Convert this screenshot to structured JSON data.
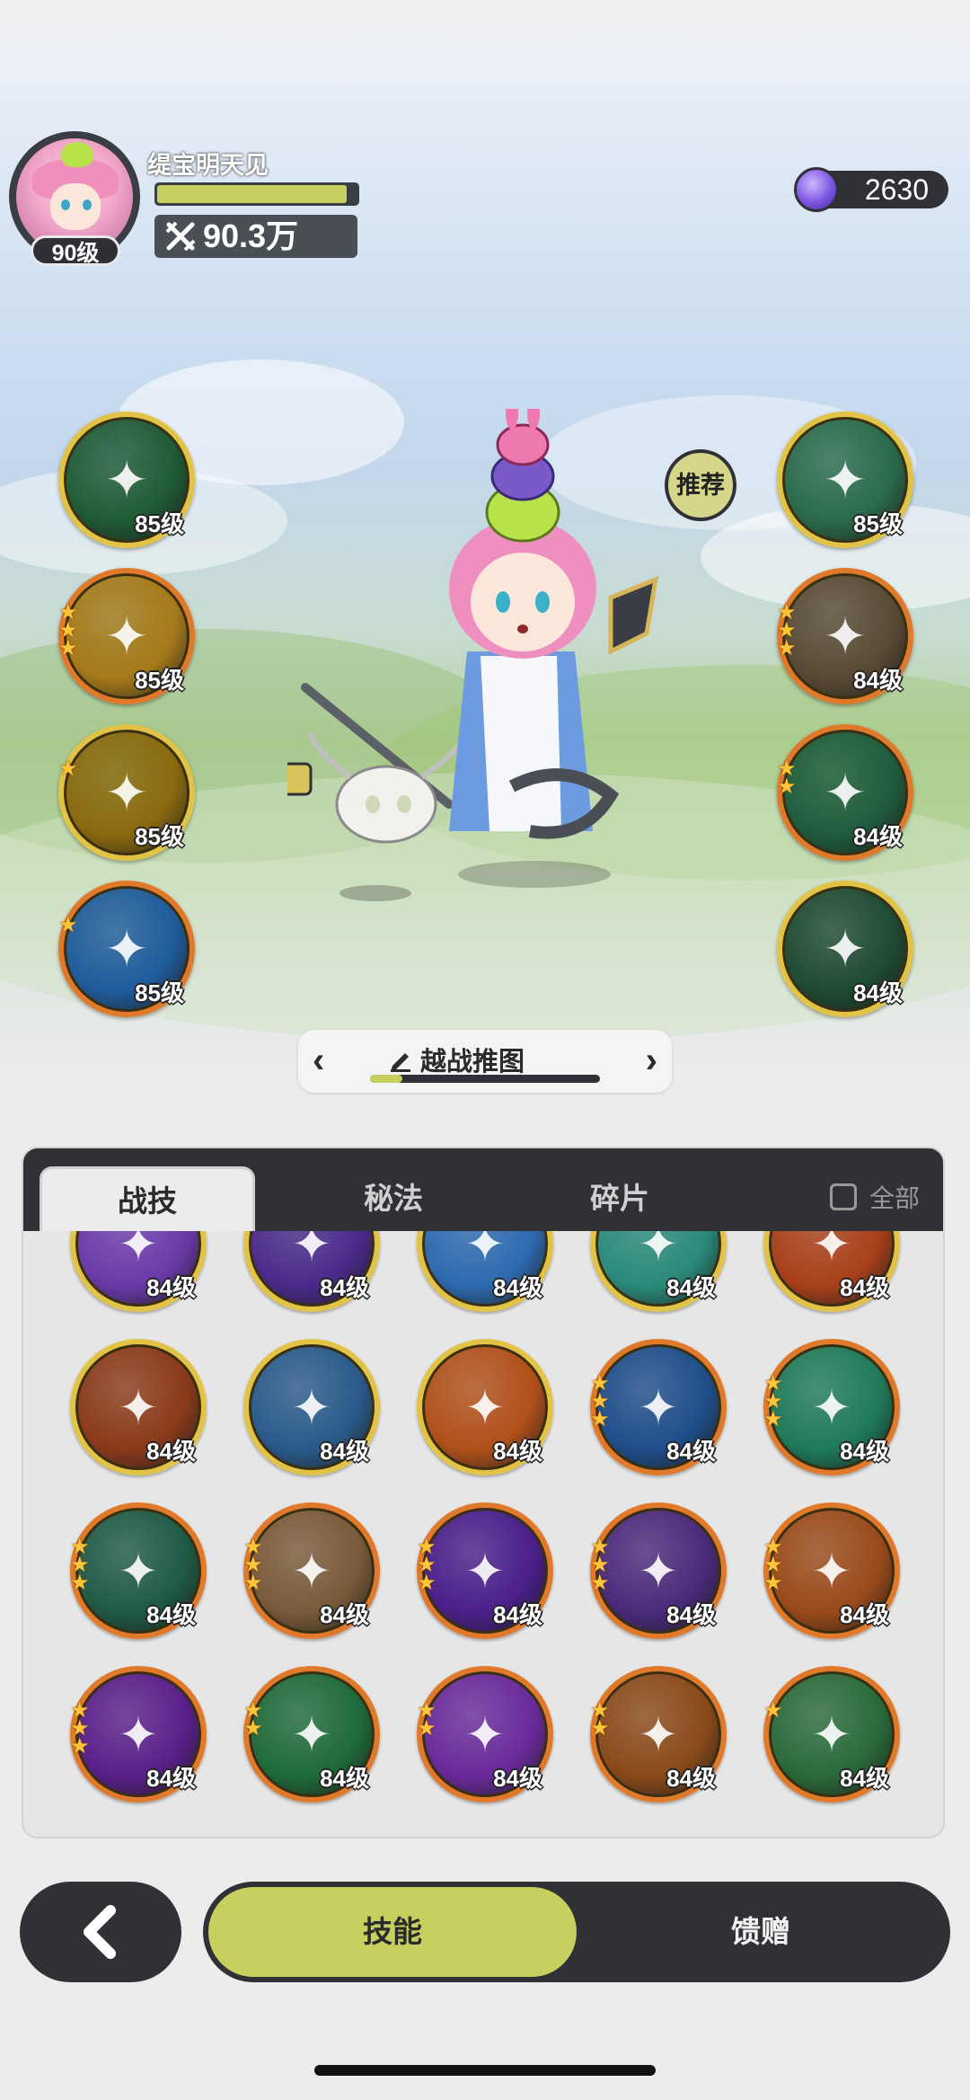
{
  "player": {
    "name": "缇宝明天见",
    "level": "90级",
    "power": "90.3万",
    "power_icon": "crossed-swords-icon",
    "hp_fraction": 0.95
  },
  "currency": {
    "icon": "purple-gem-icon",
    "amount": "2630"
  },
  "recommend_label": "推荐",
  "left_skills": [
    {
      "level": "85级",
      "stars": 0,
      "frame": "gold",
      "color": "#1f5a35",
      "icon": "healing-crosses-icon"
    },
    {
      "level": "85级",
      "stars": 3,
      "frame": "orange",
      "color": "#a57a1a",
      "icon": "golden-sparkle-crosses-icon"
    },
    {
      "level": "85级",
      "stars": 1,
      "frame": "gold",
      "color": "#8a6a10",
      "icon": "golden-pyramid-icon"
    },
    {
      "level": "85级",
      "stars": 1,
      "frame": "orange",
      "color": "#1f5c9c",
      "icon": "ice-shield-icon"
    }
  ],
  "right_skills": [
    {
      "level": "85级",
      "stars": 0,
      "frame": "gold",
      "color": "#2a6a4a",
      "icon": "green-heart-icon"
    },
    {
      "level": "84级",
      "stars": 3,
      "frame": "orange",
      "color": "#5a4a35",
      "icon": "arrow-up-holy-icon"
    },
    {
      "level": "84级",
      "stars": 2,
      "frame": "orange",
      "color": "#1f5c3e",
      "icon": "winged-emblem-icon"
    },
    {
      "level": "84级",
      "stars": 0,
      "frame": "gold",
      "color": "#1f4a33",
      "icon": "green-sparkle-icon"
    }
  ],
  "stage": {
    "title": "越战推图",
    "edit_icon": "pencil-icon",
    "progress": 0.14
  },
  "tabs": {
    "skills": "战技",
    "secret": "秘法",
    "fragments": "碎片",
    "all": "全部"
  },
  "grid": [
    {
      "level": "84级",
      "stars": 1,
      "frame": "gold",
      "color": "#6a3aa8",
      "icon": "purple-swirl-icon"
    },
    {
      "level": "84级",
      "stars": 1,
      "frame": "gold",
      "color": "#4a2a8a",
      "icon": "purple-star-burst-icon"
    },
    {
      "level": "84级",
      "stars": 0,
      "frame": "gold",
      "color": "#2e6ab0",
      "icon": "ice-splash-icon"
    },
    {
      "level": "84级",
      "stars": 0,
      "frame": "gold",
      "color": "#2a8a7a",
      "icon": "teal-vortex-icon"
    },
    {
      "level": "84级",
      "stars": 0,
      "frame": "gold",
      "color": "#a8401a",
      "icon": "fire-blast-icon"
    },
    {
      "level": "84级",
      "stars": 0,
      "frame": "gold",
      "color": "#8a3a1a",
      "icon": "fire-spiral-icon"
    },
    {
      "level": "84级",
      "stars": 0,
      "frame": "gold",
      "color": "#2a5a8a",
      "icon": "ice-shard-icon"
    },
    {
      "level": "84级",
      "stars": 0,
      "frame": "gold",
      "color": "#b0501a",
      "icon": "fireball-icon"
    },
    {
      "level": "84级",
      "stars": 3,
      "frame": "orange",
      "color": "#1f4e8a",
      "icon": "blue-flame-icon"
    },
    {
      "level": "84级",
      "stars": 3,
      "frame": "orange",
      "color": "#1f7a5a",
      "icon": "green-wind-icon"
    },
    {
      "level": "84级",
      "stars": 3,
      "frame": "orange",
      "color": "#1f5a45",
      "icon": "thorn-vine-icon"
    },
    {
      "level": "84级",
      "stars": 3,
      "frame": "orange",
      "color": "#7a5a3a",
      "icon": "tarot-cards-icon"
    },
    {
      "level": "84级",
      "stars": 3,
      "frame": "orange",
      "color": "#4a1f8a",
      "icon": "purple-eye-icon"
    },
    {
      "level": "84级",
      "stars": 3,
      "frame": "orange",
      "color": "#4a2a7a",
      "icon": "purple-hand-icon"
    },
    {
      "level": "84级",
      "stars": 3,
      "frame": "orange",
      "color": "#9a4a1a",
      "icon": "fire-wolf-icon"
    },
    {
      "level": "84级",
      "stars": 3,
      "frame": "orange",
      "color": "#5a1f8a",
      "icon": "purple-diamond-icon"
    },
    {
      "level": "84级",
      "stars": 2,
      "frame": "orange",
      "color": "#1f6a3a",
      "icon": "green-claw-icon"
    },
    {
      "level": "84级",
      "stars": 2,
      "frame": "orange",
      "color": "#6a2a9a",
      "icon": "purple-starburst-icon"
    },
    {
      "level": "84级",
      "stars": 2,
      "frame": "orange",
      "color": "#8a4a1a",
      "icon": "fire-badge-icon"
    },
    {
      "level": "84级",
      "stars": 1,
      "frame": "orange",
      "color": "#2a6a3a",
      "icon": "green-scroll-icon"
    }
  ],
  "bottom": {
    "back_icon": "chevron-left-icon",
    "skills_tab": "技能",
    "gift_tab": "馈赠"
  }
}
